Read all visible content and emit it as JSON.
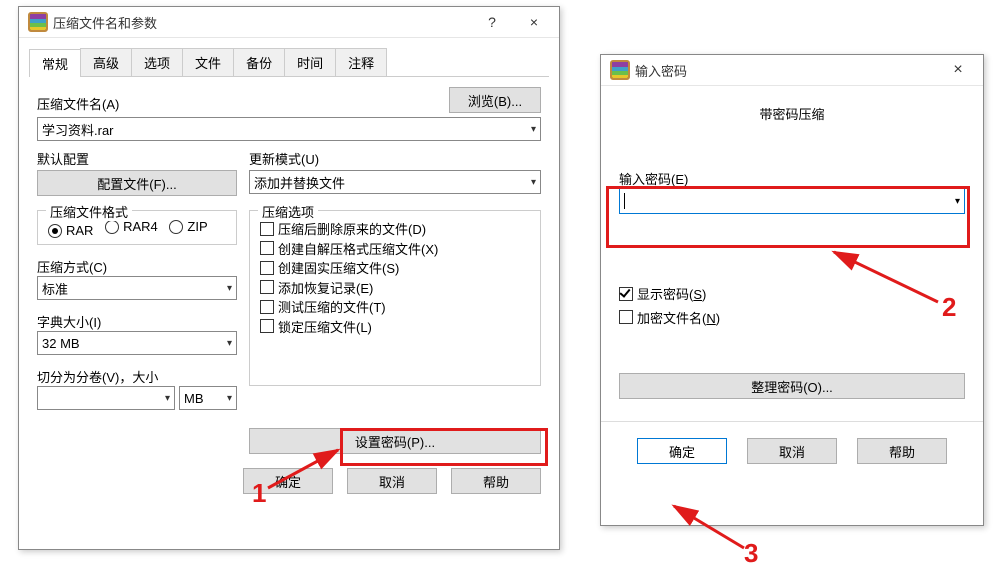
{
  "dialog1": {
    "title": "压缩文件名和参数",
    "help_btn": "?",
    "close_btn": "×",
    "tabs": [
      "常规",
      "高级",
      "选项",
      "文件",
      "备份",
      "时间",
      "注释"
    ],
    "archive_name_label": "压缩文件名(A)",
    "archive_name_value": "学习资料.rar",
    "browse_btn": "浏览(B)...",
    "default_profile_label": "默认配置",
    "profiles_btn": "配置文件(F)...",
    "update_mode_label": "更新模式(U)",
    "update_mode_value": "添加并替换文件",
    "format_group": "压缩文件格式",
    "fmt_rar": "RAR",
    "fmt_rar4": "RAR4",
    "fmt_zip": "ZIP",
    "options_group": "压缩选项",
    "opt_delete": "压缩后删除原来的文件(D)",
    "opt_sfx": "创建自解压格式压缩文件(X)",
    "opt_solid": "创建固实压缩文件(S)",
    "opt_recovery": "添加恢复记录(E)",
    "opt_test": "测试压缩的文件(T)",
    "opt_lock": "锁定压缩文件(L)",
    "method_label": "压缩方式(C)",
    "method_value": "标准",
    "dict_label": "字典大小(I)",
    "dict_value": "32 MB",
    "split_label": "切分为分卷(V)，大小",
    "split_value": "",
    "split_unit": "MB",
    "set_password_btn": "设置密码(P)...",
    "ok": "确定",
    "cancel": "取消",
    "help": "帮助"
  },
  "dialog2": {
    "title": "输入密码",
    "close_btn": "×",
    "heading": "带密码压缩",
    "enter_pw_label": "输入密码(E)",
    "pw_value": "",
    "show_pw": "显示密码(",
    "show_pw_key": "S",
    "show_pw_end": ")",
    "encrypt_names": "加密文件名(",
    "encrypt_names_key": "N",
    "encrypt_names_end": ")",
    "organize_btn": "整理密码(O)...",
    "ok": "确定",
    "cancel": "取消",
    "help": "帮助"
  },
  "annotations": {
    "n1": "1",
    "n2": "2",
    "n3": "3"
  }
}
